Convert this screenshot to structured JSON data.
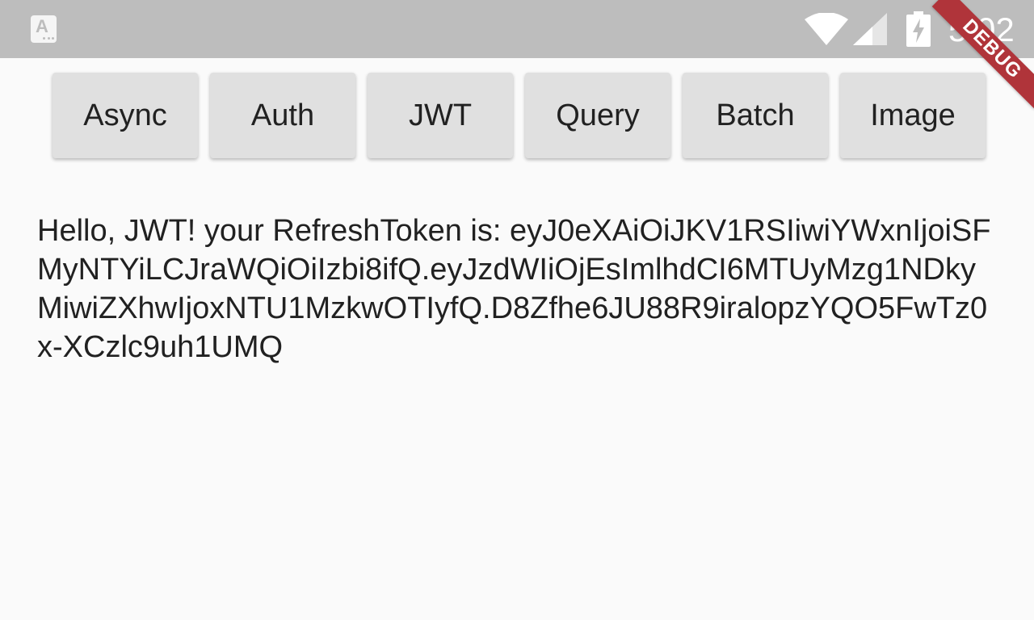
{
  "status_bar": {
    "app_indicator_letter": "A",
    "time": "5:02",
    "icons": [
      "app-notification-icon",
      "wifi-icon",
      "cell-signal-icon",
      "battery-charging-icon"
    ]
  },
  "debug_banner": {
    "label": "DEBUG"
  },
  "buttons": [
    {
      "label": "Async"
    },
    {
      "label": "Auth"
    },
    {
      "label": "JWT"
    },
    {
      "label": "Query"
    },
    {
      "label": "Batch"
    },
    {
      "label": "Image"
    }
  ],
  "result": {
    "greeting": "Hello, JWT! your RefreshToken is:",
    "token": "eyJ0eXAiOiJKV1RSIiwiYWxnIjoiSFMyNTYiLCJraWQiOiIzbi8ifQ.eyJzdWIiOjEsImlhdCI6MTUyMzg1NDkyMiwiZXhwIjoxNTU1MzkwOTIyfQ.D8Zfhe6JU88R9iralopzYQO5FwTz0x-XCzlc9uh1UMQ"
  },
  "colors": {
    "status_bar": "#bdbdbd",
    "background": "#fafafa",
    "button": "#e0e0e0",
    "debug_banner": "#b0343a",
    "text": "#212121"
  }
}
